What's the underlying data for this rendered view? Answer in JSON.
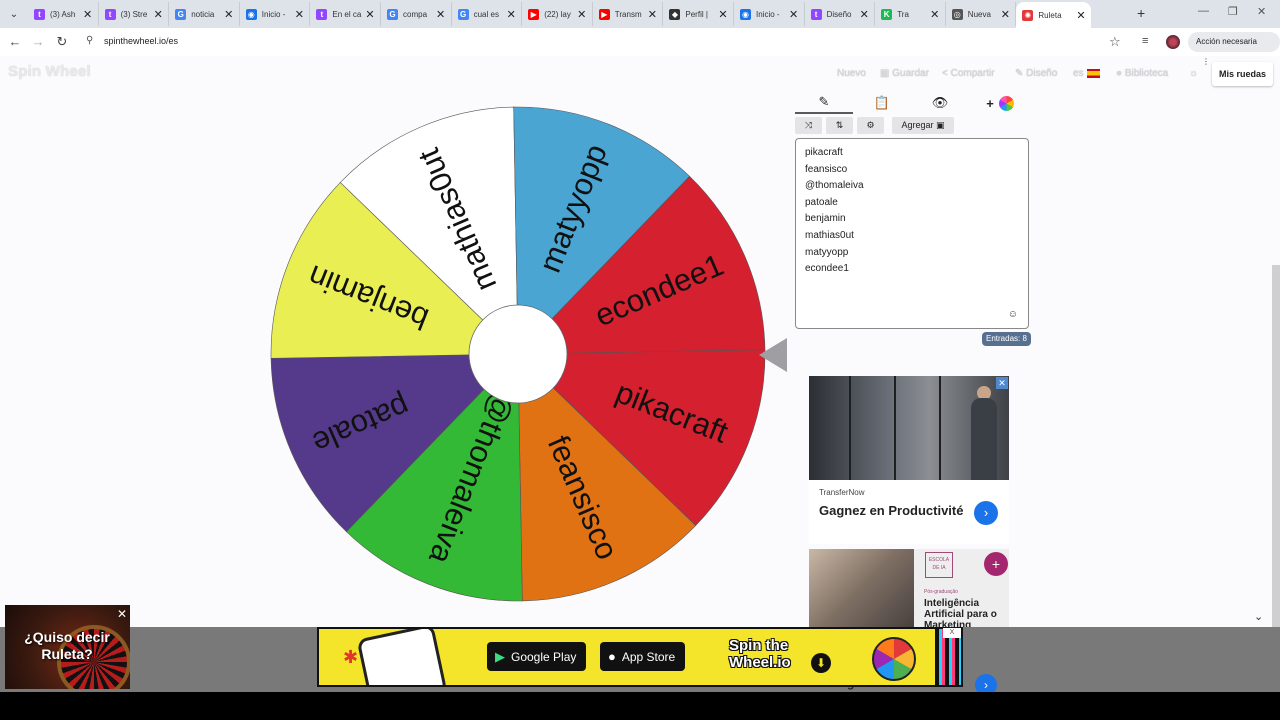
{
  "browser": {
    "tabs": [
      {
        "label": "(3) Ash",
        "color": "#9146ff",
        "glyph": "t"
      },
      {
        "label": "(3) Stre",
        "color": "#9146ff",
        "glyph": "t"
      },
      {
        "label": "noticia",
        "color": "#4285f4",
        "glyph": "G"
      },
      {
        "label": "Inicio -",
        "color": "#1a73e8",
        "glyph": "◉"
      },
      {
        "label": "En el ca",
        "color": "#9146ff",
        "glyph": "t"
      },
      {
        "label": "compa",
        "color": "#4285f4",
        "glyph": "G"
      },
      {
        "label": "cual es",
        "color": "#4285f4",
        "glyph": "G"
      },
      {
        "label": "(22) lay",
        "color": "#ff0000",
        "glyph": "▶"
      },
      {
        "label": "Transm",
        "color": "#ff0000",
        "glyph": "▶"
      },
      {
        "label": "Perfil |",
        "color": "#333333",
        "glyph": "◆"
      },
      {
        "label": "Inicio -",
        "color": "#1a73e8",
        "glyph": "◉"
      },
      {
        "label": "Diseño",
        "color": "#9146ff",
        "glyph": "t"
      },
      {
        "label": "Tra",
        "color": "#1db954",
        "glyph": "K"
      },
      {
        "label": "Nueva",
        "color": "#555555",
        "glyph": "◎"
      },
      {
        "label": "Ruleta",
        "color": "#e23a3a",
        "glyph": "✺"
      }
    ],
    "new_tab": "+",
    "url": "spinthewheel.io/es",
    "action_pill": "Acción necesaria",
    "action_pill_menu": "⋮"
  },
  "header": {
    "logo": "Spin Wheel",
    "menu": {
      "nuevo": "Nuevo",
      "guardar": "Guardar",
      "compartir": "Compartir",
      "diseno": "Diseño",
      "lang": "es",
      "biblioteca": "Biblioteca"
    },
    "my_wheels": "Mis ruedas"
  },
  "wheel": {
    "segments": [
      {
        "label": "pikacraft",
        "color": "#d4202f"
      },
      {
        "label": "feansisco",
        "color": "#e07214"
      },
      {
        "label": "@thomaleiva",
        "color": "#33b935"
      },
      {
        "label": "patoale",
        "color": "#553a8c"
      },
      {
        "label": "benjamin",
        "color": "#e9ee52"
      },
      {
        "label": "mathias0ut",
        "color": "#ffffff"
      },
      {
        "label": "matyyopp",
        "color": "#4ba5d3"
      },
      {
        "label": "econdee1",
        "color": "#d4202f"
      }
    ]
  },
  "editor": {
    "tab_icons": [
      "✎",
      "📋",
      "👁",
      "+"
    ],
    "toolbar": {
      "shuffle": "⤨",
      "sort": "⇅",
      "settings": "⚙",
      "add_label": "Agregar"
    },
    "entries": [
      "pikacraft",
      "feansisco",
      "@thomaleiva",
      "patoale",
      "benjamin",
      "mathias0ut",
      "matyyopp",
      "econdee1"
    ],
    "emoji_icon": "☺",
    "count_label": "Entradas: 8"
  },
  "ads": {
    "ad1": {
      "brand": "TransferNow",
      "title": "Gagnez en Productivité",
      "go": "›"
    },
    "ad2": {
      "logo": "ESCOLA DE IA",
      "tag": "Pós-graduação",
      "title": "Inteligência Artificial para o Marketing Estratégico",
      "plus": "+"
    },
    "ad3": {
      "title": "Inteligência Artificial",
      "go": "›"
    }
  },
  "banner": {
    "google_play": "Google Play",
    "app_store": "App Store",
    "brand": "Spin the Wheel.io",
    "close": "X"
  },
  "promo": {
    "text": "¿Quiso decir Ruleta?",
    "close": "✕"
  }
}
